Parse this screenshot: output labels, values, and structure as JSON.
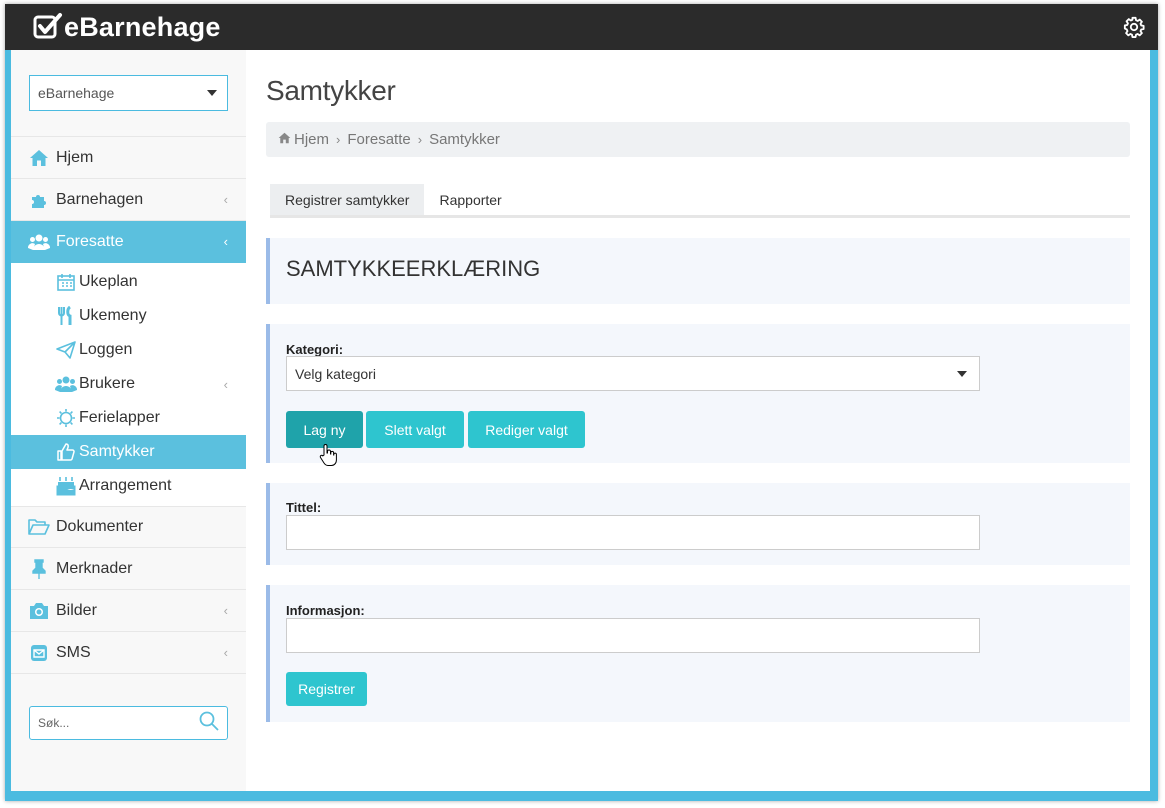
{
  "app": {
    "name": "eBarnehage"
  },
  "sidebar": {
    "select_value": "eBarnehage",
    "items": [
      {
        "label": "Hjem",
        "icon": "home-icon"
      },
      {
        "label": "Barnehagen",
        "icon": "puzzle-icon"
      },
      {
        "label": "Foresatte",
        "icon": "users-icon"
      },
      {
        "label": "Dokumenter",
        "icon": "folder-icon"
      },
      {
        "label": "Merknader",
        "icon": "pin-icon"
      },
      {
        "label": "Bilder",
        "icon": "camera-icon"
      },
      {
        "label": "SMS",
        "icon": "envelope-icon"
      }
    ],
    "subitems": [
      {
        "label": "Ukeplan",
        "icon": "calendar-icon"
      },
      {
        "label": "Ukemeny",
        "icon": "utensils-icon"
      },
      {
        "label": "Loggen",
        "icon": "paper-plane-icon"
      },
      {
        "label": "Brukere",
        "icon": "users-icon"
      },
      {
        "label": "Ferielapper",
        "icon": "sun-icon"
      },
      {
        "label": "Samtykker",
        "icon": "thumbs-up-icon"
      },
      {
        "label": "Arrangement",
        "icon": "cake-icon"
      }
    ],
    "search_placeholder": "Søk...",
    "chevron": "‹"
  },
  "main": {
    "title": "Samtykker",
    "breadcrumb": [
      "Hjem",
      "Foresatte",
      "Samtykker"
    ],
    "breadcrumb_sep": "›",
    "tabs": [
      "Registrer samtykker",
      "Rapporter"
    ],
    "section_title": "SAMTYKKEERKLÆRING",
    "kategori_label": "Kategori:",
    "kategori_value": "Velg kategori",
    "buttons": {
      "new": "Lag ny",
      "delete": "Slett valgt",
      "edit": "Rediger valgt"
    },
    "tittel_label": "Tittel:",
    "informasjon_label": "Informasjon:",
    "submit": "Registrer"
  },
  "colors": {
    "accent": "#5bc0de",
    "topbar": "#2b2b2b",
    "button": "#2ec5cf",
    "button_active": "#1fa3aa"
  }
}
